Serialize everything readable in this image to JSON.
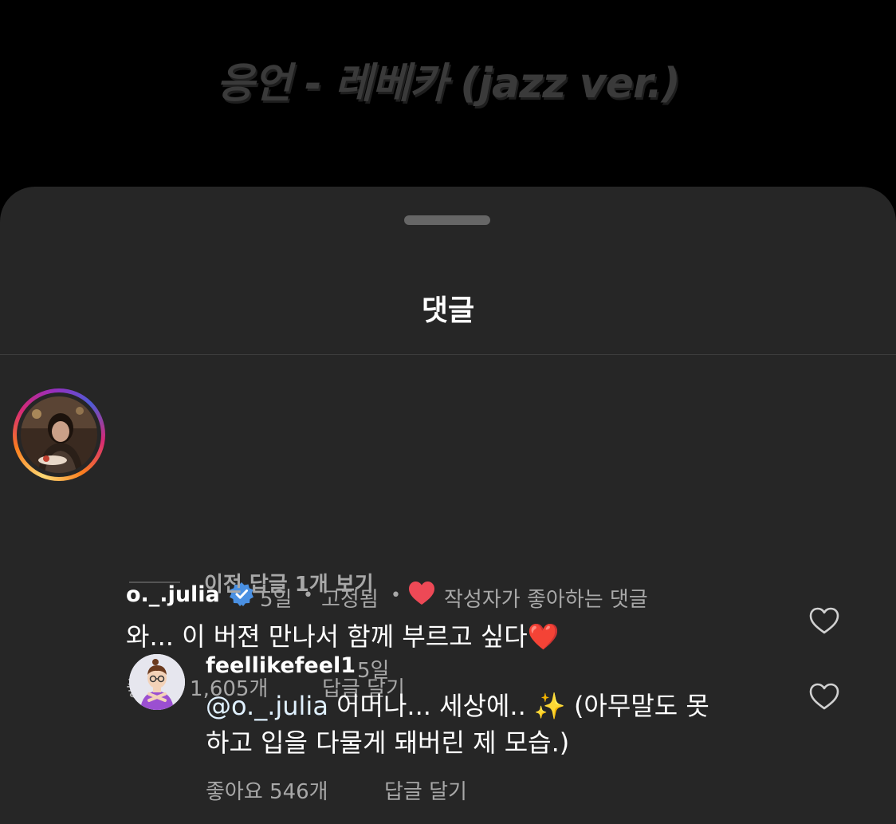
{
  "background": {
    "song_title": "응언 - 레베카 (jazz ver.)"
  },
  "sheet": {
    "title": "댓글"
  },
  "comments": [
    {
      "username": "o._.julia",
      "verified": true,
      "time": "5일",
      "pinned_label": "고정됨",
      "author_liked_label": "작성자가 좋아하는 댓글",
      "text": "와... 이 버젼 만나서 함께 부르고 싶다❤️",
      "likes_label": "좋아요 1,605개",
      "reply_label": "답글 달기",
      "icons": [
        "avatar",
        "verified-badge-icon",
        "red-heart-icon",
        "heart-outline-icon"
      ],
      "colors": {
        "verified": "#4a90e2",
        "heart": "#ed4956"
      }
    }
  ],
  "view_replies": {
    "label": "이전 답글 1개 보기"
  },
  "replies": [
    {
      "username": "feellikefeel1",
      "time": "5일",
      "mention": "@o._.julia",
      "text_line1": " 어머나... 세상에.. ✨ (아무말도 못",
      "text_line2": "하고 입을 다물게 돼버린 제 모습.)",
      "likes_label": "좋아요 546개",
      "reply_label": "답글 달기"
    }
  ],
  "separator": "•"
}
